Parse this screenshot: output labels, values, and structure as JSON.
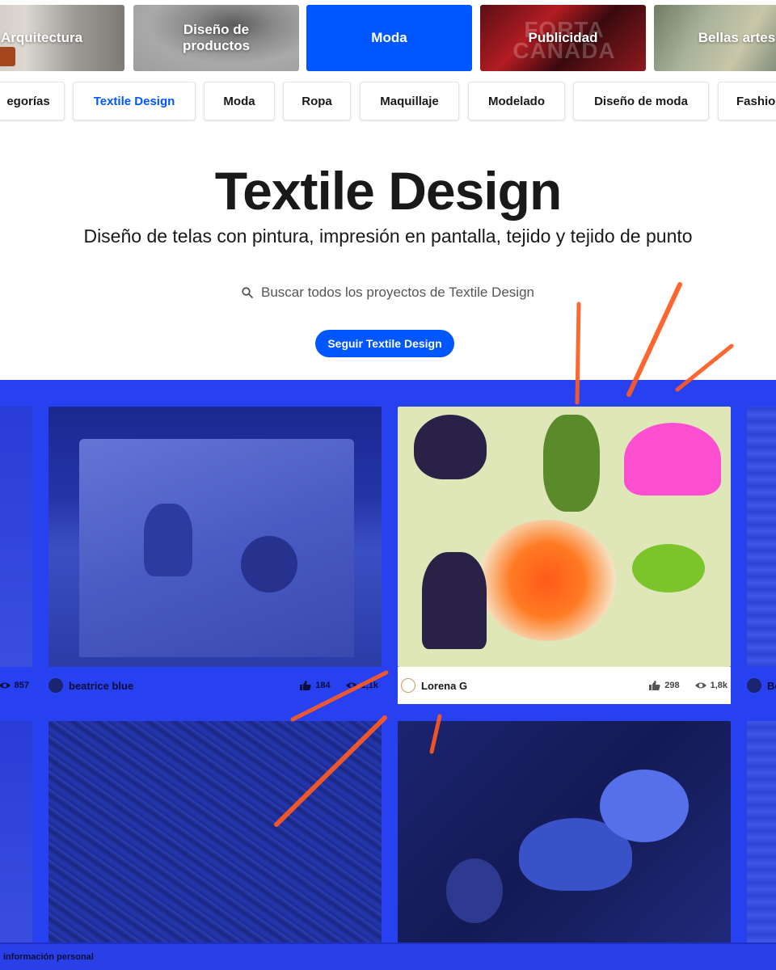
{
  "categories": [
    {
      "label": "Arquitectura"
    },
    {
      "label": "Diseño de productos"
    },
    {
      "label": "Moda"
    },
    {
      "label": "Publicidad"
    },
    {
      "label": "Bellas artes"
    }
  ],
  "tags": [
    {
      "label": "egorías"
    },
    {
      "label": "Textile Design"
    },
    {
      "label": "Moda"
    },
    {
      "label": "Ropa"
    },
    {
      "label": "Maquillaje"
    },
    {
      "label": "Modelado"
    },
    {
      "label": "Diseño de moda"
    },
    {
      "label": "Fashio"
    }
  ],
  "hero": {
    "title": "Textile Design",
    "description": "Diseño de telas con pintura, impresión en pantalla, tejido y tejido de punto",
    "search_placeholder": "Buscar todos los proyectos de Textile Design",
    "follow_label": "Seguir Textile Design"
  },
  "projects": [
    {
      "owner": "",
      "likes": "",
      "views": "857"
    },
    {
      "owner": "beatrice blue",
      "likes": "184",
      "views": "1,1k"
    },
    {
      "owner": "Lorena G",
      "likes": "298",
      "views": "1,8k"
    },
    {
      "owner": "Be",
      "likes": "",
      "views": ""
    }
  ],
  "footer": {
    "text": "información personal"
  },
  "colors": {
    "accent": "#0057ff",
    "grid_overlay": "#2740f0",
    "scribble": "#ff5a1f"
  },
  "icons": [
    "search-icon",
    "thumbs-up-icon",
    "eye-icon"
  ]
}
